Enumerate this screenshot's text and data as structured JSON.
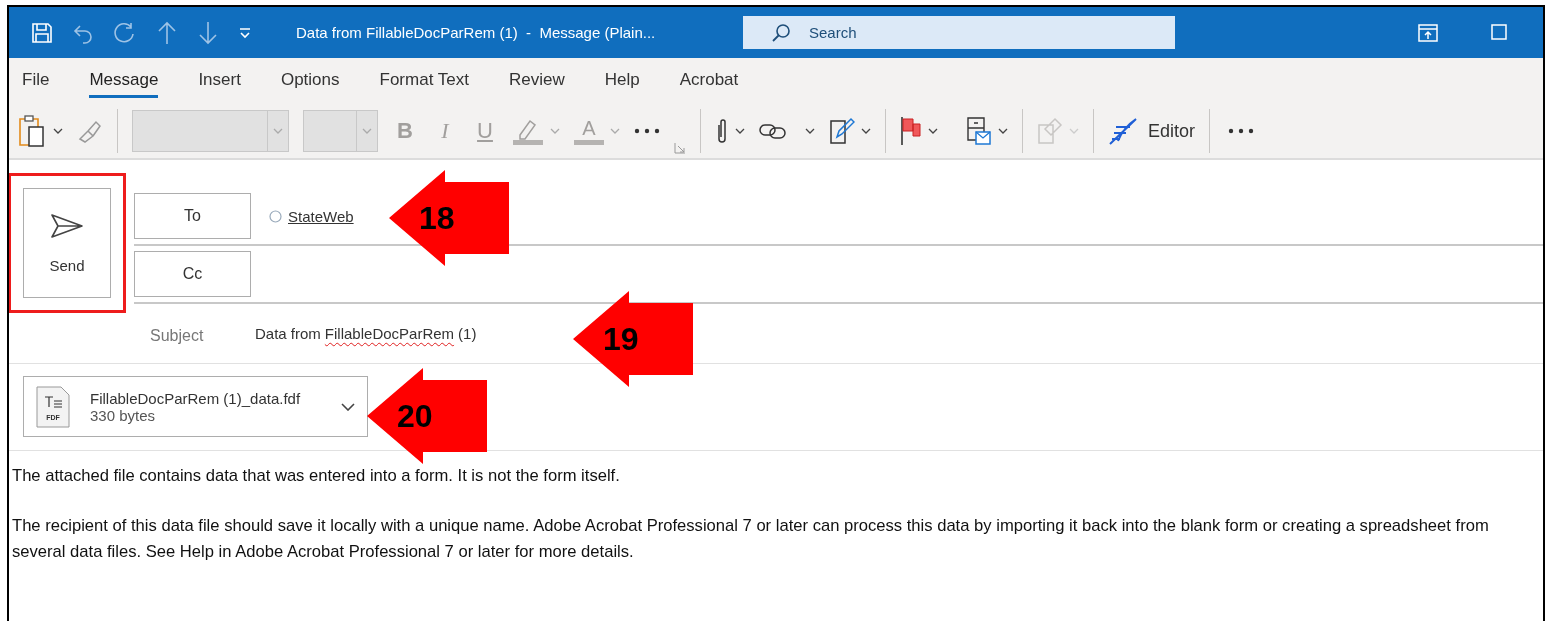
{
  "window": {
    "title": "Data from FillableDocParRem (1)  -  Message (Plain...",
    "search_placeholder": "Search"
  },
  "tabs": [
    {
      "label": "File",
      "selected": false
    },
    {
      "label": "Message",
      "selected": true
    },
    {
      "label": "Insert",
      "selected": false
    },
    {
      "label": "Options",
      "selected": false
    },
    {
      "label": "Format Text",
      "selected": false
    },
    {
      "label": "Review",
      "selected": false
    },
    {
      "label": "Help",
      "selected": false
    },
    {
      "label": "Acrobat",
      "selected": false
    }
  ],
  "toolbar": {
    "format_glyphs": [
      "B",
      "I",
      "U"
    ],
    "font_color_glyph": "A",
    "editor_label": "Editor"
  },
  "compose": {
    "send": {
      "label": "Send",
      "highlighted": true
    },
    "to": {
      "label": "To",
      "recipient": "StateWeb"
    },
    "cc": {
      "label": "Cc"
    },
    "subject": {
      "label": "Subject",
      "parts": [
        {
          "text": "Data from",
          "misspelled": false
        },
        {
          "text": "FillableDocParRem",
          "misspelled": true
        },
        {
          "text": "(1)",
          "misspelled": false
        }
      ]
    },
    "attachment": {
      "name": "FillableDocParRem (1)_data.fdf",
      "size": "330 bytes",
      "type_label": "FDF"
    }
  },
  "body": [
    "The attached file contains data that was entered into a form. It is not the form itself.",
    "The recipient of this data file should save it locally with a unique name. Adobe Acrobat Professional 7 or later can process this data by importing it back into the blank form or creating a spreadsheet from several data files. See Help in Adobe Acrobat Professional 7 or later for more details."
  ],
  "callouts": [
    {
      "number": "18"
    },
    {
      "number": "19"
    },
    {
      "number": "20"
    }
  ]
}
